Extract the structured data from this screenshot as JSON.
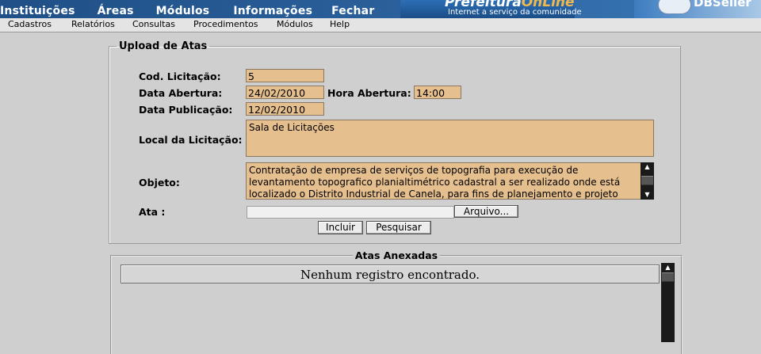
{
  "top_menu": [
    "Instituições",
    "Áreas",
    "Módulos",
    "Informações",
    "Fechar"
  ],
  "brand": {
    "title_part1": "Prefeitura",
    "title_part2": "OnLine",
    "subtitle": "Internet a serviço da comunidade",
    "right_logo_text": "DBSeller"
  },
  "sub_menu": [
    "Cadastros",
    "Relatórios",
    "Consultas",
    "Procedimentos",
    "Módulos",
    "Help"
  ],
  "upload_form": {
    "legend": "Upload de Atas",
    "cod_licitacao_label": "Cod. Licitação:",
    "cod_licitacao_value": "5",
    "data_abertura_label": "Data Abertura:",
    "data_abertura_value": "24/02/2010",
    "hora_abertura_label": "Hora Abertura:",
    "hora_abertura_value": "14:00",
    "data_publicacao_label": "Data Publicação:",
    "data_publicacao_value": "12/02/2010",
    "local_label": "Local da Licitação:",
    "local_value": "Sala de Licitações",
    "objeto_label": "Objeto:",
    "objeto_value": "Contratação de empresa de serviços de topografia para execução de levantamento topografico planialtimétrico cadastral a ser realizado onde está localizado o Distrito Industrial de Canela, para fins de planejamento e projeto",
    "ata_label": "Ata :",
    "arquivo_button": "Arquivo...",
    "incluir_button": "Incluir",
    "pesquisar_button": "Pesquisar"
  },
  "atas_anexadas": {
    "legend": "Atas Anexadas",
    "empty_message": "Nenhum registro encontrado."
  }
}
